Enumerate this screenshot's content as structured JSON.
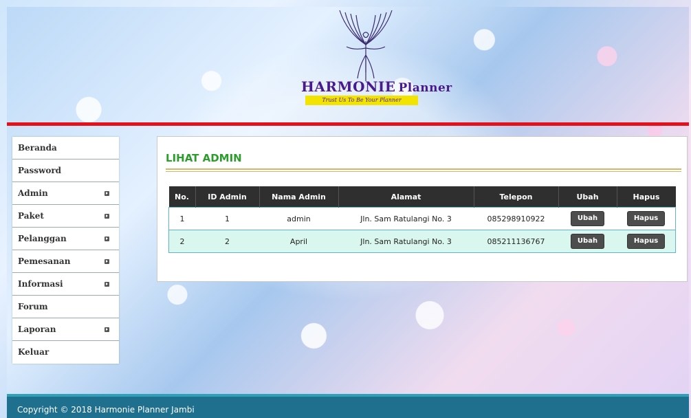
{
  "header": {
    "brand_main": "HARMONIE",
    "brand_sub": "Planner",
    "tagline": "Trust Us To Be Your Planner",
    "logo_icon": "phoenix-icon"
  },
  "sidebar": {
    "items": [
      {
        "label": "Beranda",
        "has_submenu": false
      },
      {
        "label": "Password",
        "has_submenu": false
      },
      {
        "label": "Admin",
        "has_submenu": true
      },
      {
        "label": "Paket",
        "has_submenu": true
      },
      {
        "label": "Pelanggan",
        "has_submenu": true
      },
      {
        "label": "Pemesanan",
        "has_submenu": true
      },
      {
        "label": "Informasi",
        "has_submenu": true
      },
      {
        "label": "Forum",
        "has_submenu": false
      },
      {
        "label": "Laporan",
        "has_submenu": true
      },
      {
        "label": "Keluar",
        "has_submenu": false
      }
    ]
  },
  "main": {
    "title": "LIHAT ADMIN",
    "table": {
      "columns": [
        "No.",
        "ID Admin",
        "Nama Admin",
        "Alamat",
        "Telepon",
        "Ubah",
        "Hapus"
      ],
      "rows": [
        {
          "no": "1",
          "id": "1",
          "nama": "admin",
          "alamat": "Jln. Sam Ratulangi No. 3",
          "telepon": "085298910922",
          "ubah": "Ubah",
          "hapus": "Hapus"
        },
        {
          "no": "2",
          "id": "2",
          "nama": "April",
          "alamat": "Jln. Sam Ratulangi No. 3",
          "telepon": "085211136767",
          "ubah": "Ubah",
          "hapus": "Hapus"
        }
      ]
    }
  },
  "footer": {
    "text": "Copyright © 2018 Harmonie Planner Jambi"
  },
  "colors": {
    "brand": "#4a1a8c",
    "title_green": "#2a9d2a",
    "red_bar": "#e2111b",
    "footer": "#1f6f8e"
  }
}
